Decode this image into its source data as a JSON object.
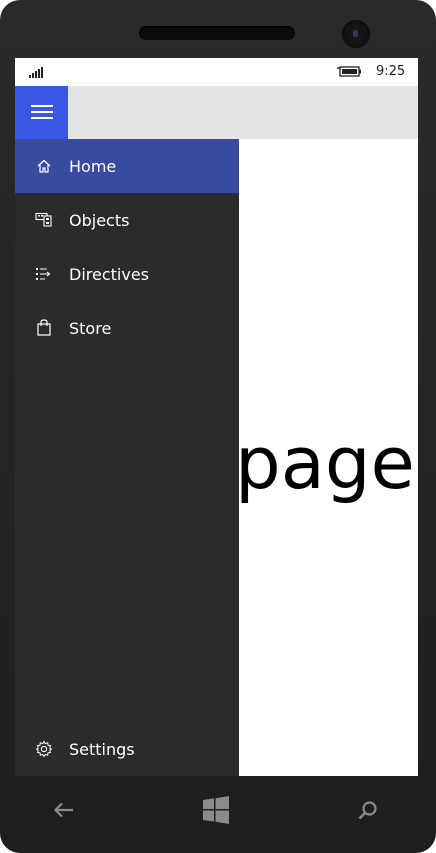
{
  "status_bar": {
    "time": "9:25",
    "signal_icon": "signal-bars-icon",
    "battery_icon": "battery-icon"
  },
  "header": {
    "menu_icon": "hamburger-icon"
  },
  "nav": {
    "items": [
      {
        "label": "Home",
        "icon": "home-icon",
        "selected": true
      },
      {
        "label": "Objects",
        "icon": "objects-icon",
        "selected": false
      },
      {
        "label": "Directives",
        "icon": "directives-icon",
        "selected": false
      },
      {
        "label": "Store",
        "icon": "store-bag-icon",
        "selected": false
      }
    ],
    "footer": {
      "label": "Settings",
      "icon": "gear-icon"
    }
  },
  "content": {
    "text": "page"
  },
  "hardware_buttons": [
    "back-arrow-icon",
    "windows-start-icon",
    "search-icon"
  ],
  "colors": {
    "accent": "#3a56e4",
    "selected_item": "#3a4aa0",
    "pane_background": "#2b2b2b",
    "header_background": "#e4e4e4"
  }
}
